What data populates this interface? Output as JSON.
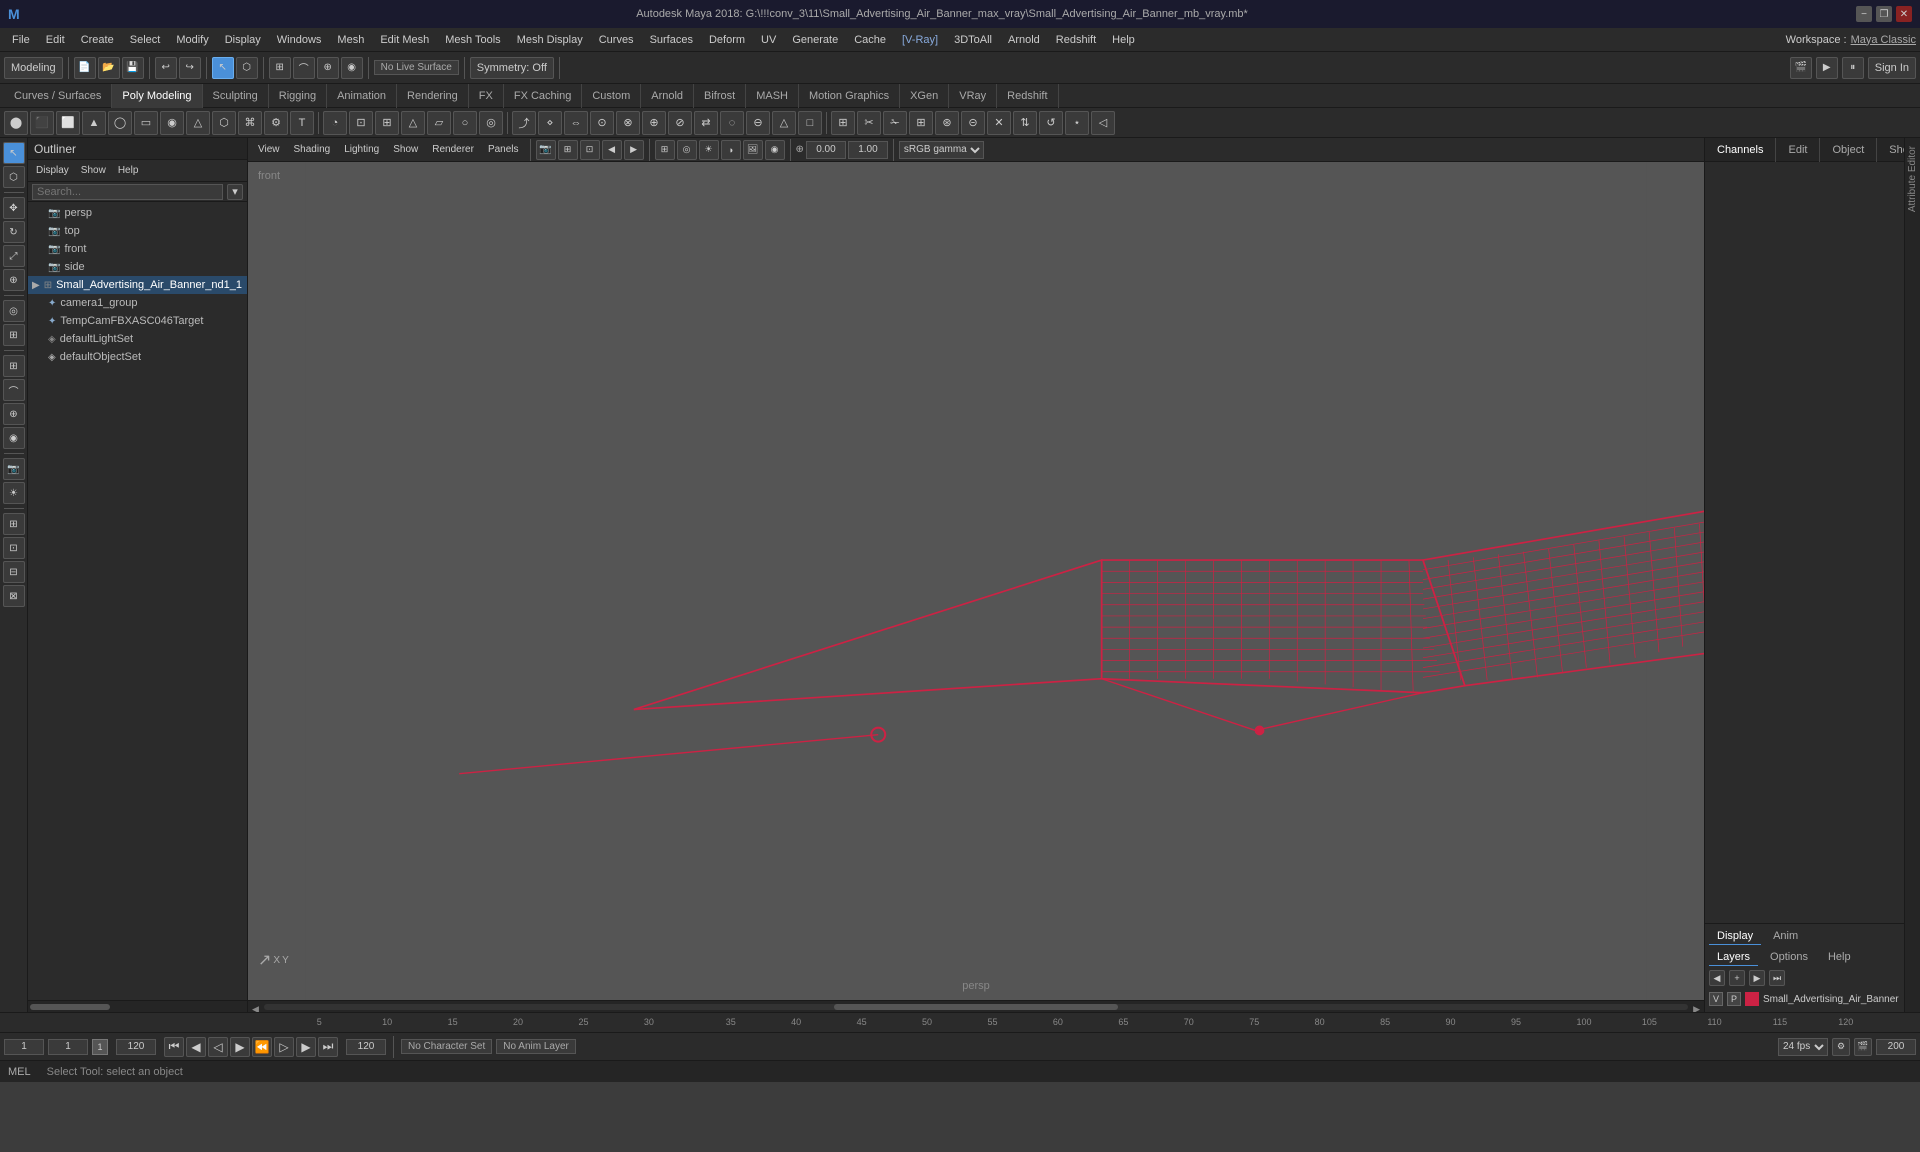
{
  "titlebar": {
    "title": "Autodesk Maya 2018: G:\\!!!conv_3\\11\\Small_Advertising_Air_Banner_max_vray\\Small_Advertising_Air_Banner_mb_vray.mb*",
    "min": "−",
    "restore": "❐",
    "close": "✕"
  },
  "menubar": {
    "items": [
      "File",
      "Edit",
      "Create",
      "Select",
      "Modify",
      "Display",
      "Windows",
      "Mesh",
      "Edit Mesh",
      "Mesh Tools",
      "Mesh Display",
      "Curves",
      "Surfaces",
      "Deform",
      "UV",
      "Generate",
      "Cache",
      "V-Ray",
      "3DToAll",
      "Arnold",
      "Redshift",
      "Help"
    ],
    "workspace_label": "Workspace :",
    "workspace_value": "Maya Classic",
    "modeling_label": "Modeling",
    "no_live_surface": "No Live Surface",
    "symmetry_off": "Symmetry: Off",
    "sign_in": "Sign In"
  },
  "tabsbar": {
    "items": [
      "Curves / Surfaces",
      "Poly Modeling",
      "Sculpting",
      "Rigging",
      "Animation",
      "Rendering",
      "FX",
      "FX Caching",
      "Custom",
      "Arnold",
      "Bifrost",
      "MASH",
      "Motion Graphics",
      "XGen",
      "VRay",
      "Redshift"
    ]
  },
  "outliner": {
    "title": "Outliner",
    "display_label": "Display",
    "show_label": "Show",
    "help_label": "Help",
    "search_placeholder": "Search...",
    "items": [
      {
        "name": "persp",
        "type": "camera",
        "level": 1
      },
      {
        "name": "top",
        "type": "camera",
        "level": 1
      },
      {
        "name": "front",
        "type": "camera",
        "level": 1
      },
      {
        "name": "side",
        "type": "camera",
        "level": 1
      },
      {
        "name": "Small_Advertising_Air_Banner_nd1_1",
        "type": "mesh",
        "level": 0
      },
      {
        "name": "camera1_group",
        "type": "group",
        "level": 1
      },
      {
        "name": "TempCamFBXASC046Target",
        "type": "mesh",
        "level": 1
      },
      {
        "name": "defaultLightSet",
        "type": "light",
        "level": 1
      },
      {
        "name": "defaultObjectSet",
        "type": "set",
        "level": 1
      }
    ]
  },
  "viewport": {
    "view_label": "View",
    "shading_label": "Shading",
    "lighting_label": "Lighting",
    "show_label": "Show",
    "renderer_label": "Renderer",
    "panels_label": "Panels",
    "persp_label": "persp",
    "gamma_label": "sRGB gamma",
    "value1": "0.00",
    "value2": "1.00"
  },
  "right_panel": {
    "channels_label": "Channels",
    "edit_label": "Edit",
    "object_label": "Object",
    "show_label": "Show",
    "display_label": "Display",
    "anim_label": "Anim",
    "layers_label": "Layers",
    "options_label": "Options",
    "help_label": "Help",
    "layer_v": "V",
    "layer_p": "P",
    "layer_name": "Small_Advertising_Air_Banner"
  },
  "timeline": {
    "start": "1",
    "end": "120",
    "anim_end": "200",
    "current": "1",
    "current_frame": "1",
    "fps": "24 fps",
    "no_character_set": "No Character Set",
    "no_anim_layer": "No Anim Layer",
    "ruler_marks": [
      "5",
      "10",
      "15",
      "20",
      "25",
      "30",
      "35",
      "40",
      "45",
      "50",
      "55",
      "60",
      "65",
      "70",
      "75",
      "80",
      "85",
      "90",
      "95",
      "100",
      "105",
      "110",
      "115",
      "120"
    ]
  },
  "status_bar": {
    "mel_label": "MEL",
    "status_text": "Select Tool: select an object"
  },
  "icons": {
    "unicode": {
      "arrow": "▶",
      "circle": "●",
      "square": "■",
      "triangle": "▲",
      "camera": "📷",
      "select": "↖",
      "move": "✥",
      "rotate": "↻",
      "scale": "⤢",
      "snap": "⊕",
      "mesh": "⊞",
      "light": "💡",
      "play": "▶",
      "pause": "⏸",
      "prev": "⏮",
      "next": "⏭",
      "rewind": "⏪",
      "ffwd": "⏩",
      "frame_prev": "◀",
      "frame_next": "▶",
      "key": "◆",
      "search": "🔍"
    }
  },
  "scene": {
    "color": "#cc2244",
    "bg_color": "#555555",
    "viewport_bg": "#555555"
  }
}
